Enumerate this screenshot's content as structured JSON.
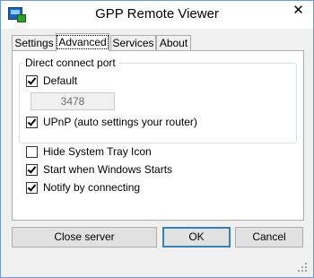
{
  "window": {
    "title": "GPP Remote Viewer",
    "close_glyph": "✕",
    "icon": "app-remote-viewer-icon"
  },
  "tabs": [
    {
      "label": "Settings",
      "active": false
    },
    {
      "label": "Advanced",
      "active": true
    },
    {
      "label": "Services",
      "active": false
    },
    {
      "label": "About",
      "active": false
    }
  ],
  "direct_connect": {
    "group_title": "Direct connect port",
    "default_label": "Default",
    "default_checked": true,
    "port_value": "3478",
    "upnp_label": "UPnP (auto settings your router)",
    "upnp_checked": true
  },
  "options": {
    "hide_tray_label": "Hide System Tray Icon",
    "hide_tray_checked": false,
    "start_windows_label": "Start when Windows Starts",
    "start_windows_checked": true,
    "notify_label": "Notify by connecting",
    "notify_checked": true
  },
  "buttons": {
    "close_server": "Close server",
    "ok": "OK",
    "cancel": "Cancel"
  }
}
